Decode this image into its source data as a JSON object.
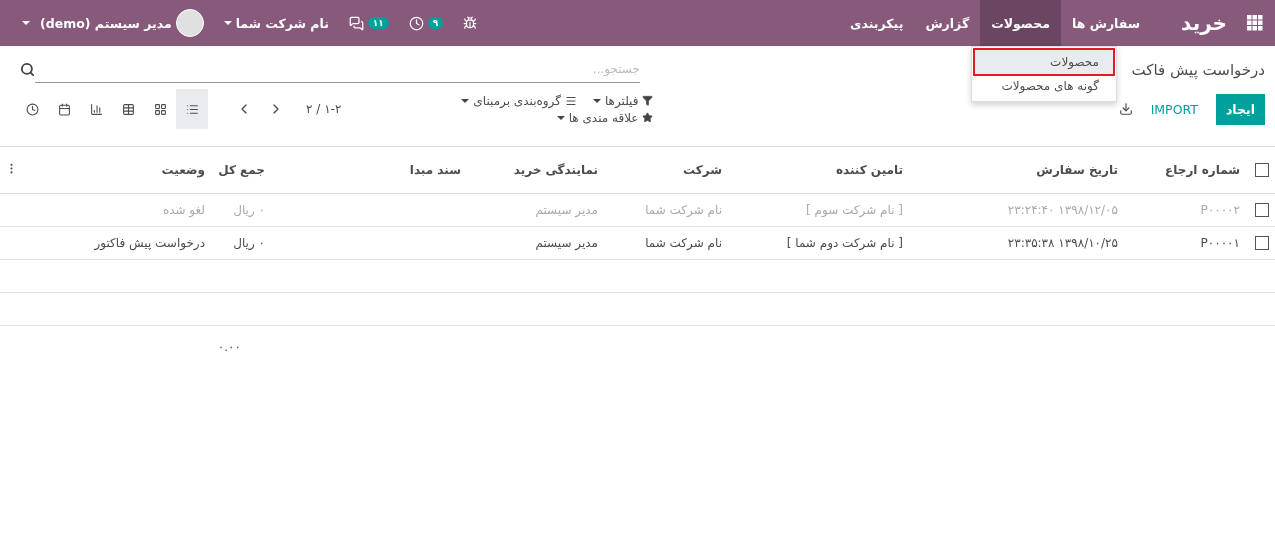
{
  "navbar": {
    "brand": "خرید",
    "menu": [
      {
        "label": "سفارش ها",
        "selected": false
      },
      {
        "label": "محصولات",
        "selected": true
      },
      {
        "label": "گزارش",
        "selected": false
      },
      {
        "label": "پیکربندی",
        "selected": false
      }
    ],
    "activity_count": "۹",
    "message_count": "۱۱",
    "company": "نام شرکت شما",
    "user": "مدیر سیستم (demo)"
  },
  "dropdown": [
    {
      "label": "محصولات",
      "highlighted": true
    },
    {
      "label": "گونه های محصولات",
      "highlighted": false
    }
  ],
  "breadcrumb": "درخواست پیش فاکت",
  "buttons": {
    "create": "ایجاد",
    "import": "IMPORT"
  },
  "search": {
    "placeholder": "جستجو..."
  },
  "filters": {
    "filter": "فیلترها",
    "group_by": "گروه‌بندی برمبنای",
    "favorites": "علاقه مندی ها"
  },
  "pager": "۱-۲ / ۲",
  "views": [
    {
      "kind": "list",
      "selected": true
    },
    {
      "kind": "kanban",
      "selected": false
    },
    {
      "kind": "pivot",
      "selected": false
    },
    {
      "kind": "graph",
      "selected": false
    },
    {
      "kind": "calendar",
      "selected": false
    },
    {
      "kind": "activity",
      "selected": false
    }
  ],
  "table": {
    "all_checked": false,
    "columns": [
      "شماره ارجاع",
      "تاریخ سفارش",
      "تامین کننده",
      "شرکت",
      "نمایندگی خرید",
      "سند مبدا",
      "جمع کل",
      "وضعیت"
    ],
    "rows": [
      {
        "muted": true,
        "checked": false,
        "cells": [
          "P۰۰۰۰۲",
          "۱۳۹۸/۱۲/۰۵ ۲۳:۲۴:۴۰",
          "[ نام شرکت سوم ]",
          "نام شرکت شما",
          "مدیر سیستم",
          "",
          "۰ ریال",
          "لغو شده"
        ]
      },
      {
        "muted": false,
        "checked": false,
        "cells": [
          "P۰۰۰۰۱",
          "۱۳۹۸/۱۰/۲۵ ۲۳:۳۵:۳۸",
          "[ نام شرکت دوم شما ]",
          "نام شرکت شما",
          "مدیر سیستم",
          "",
          "۰ ریال",
          "درخواست پیش فاکتور"
        ]
      }
    ],
    "total": "۰.۰۰"
  }
}
